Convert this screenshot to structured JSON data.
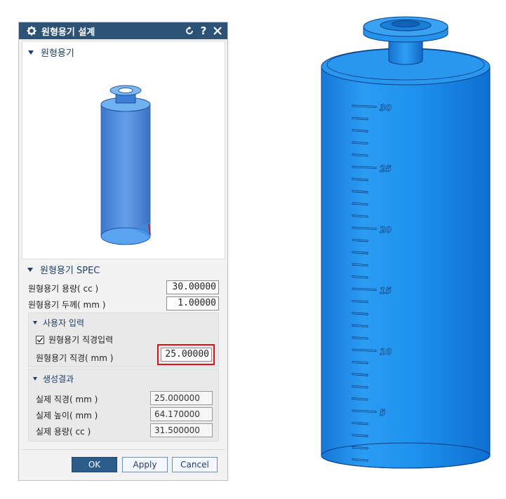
{
  "dialog": {
    "title": "원형용기 설계",
    "icons": {
      "settings": "gear-icon",
      "reset": "reset-icon",
      "help": "help-icon",
      "close": "close-icon"
    },
    "preview_section": {
      "label": "원형용기"
    },
    "spec_section": {
      "label": "원형용기 SPEC",
      "capacity": {
        "label": "원형용기 용량( cc )",
        "value": "30.00000"
      },
      "thickness": {
        "label": "원형용기 두께( mm )",
        "value": "1.00000"
      },
      "user_input": {
        "label": "사용자 입력",
        "checkbox_label": "원형용기 직경입력",
        "checked": true,
        "diameter": {
          "label": "원형용기 직경( mm )",
          "value": "25.00000"
        }
      },
      "result": {
        "label": "생성결과",
        "actual_diameter": {
          "label": "실제 직경( mm )",
          "value": "25.000000"
        },
        "actual_height": {
          "label": "실제 높이( mm )",
          "value": "64.170000"
        },
        "actual_capacity": {
          "label": "실제 용량( cc )",
          "value": "31.500000"
        }
      }
    },
    "buttons": {
      "ok": "OK",
      "apply": "Apply",
      "cancel": "Cancel"
    }
  },
  "model_view": {
    "scale_labels": [
      "30",
      "25",
      "20",
      "15",
      "10",
      "5"
    ],
    "colors": {
      "body": "#1e90e6",
      "highlight": "#e01010",
      "title_bar": "#2c5276"
    }
  }
}
